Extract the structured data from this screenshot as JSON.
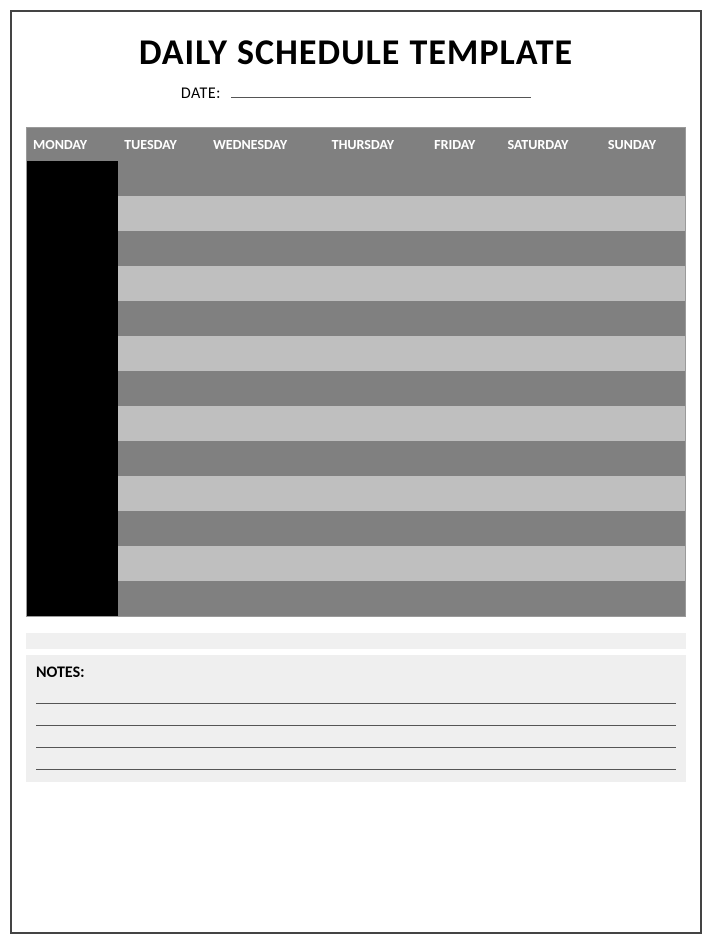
{
  "title": "DAILY SCHEDULE TEMPLATE",
  "date_label": "DATE:",
  "date_value": "",
  "columns": [
    "MONDAY",
    "TUESDAY",
    "WEDNESDAY",
    "THURSDAY",
    "FRIDAY",
    "SATURDAY",
    "SUNDAY"
  ],
  "rows": [
    {
      "stripe": "dark",
      "cells": [
        "",
        "",
        "",
        "",
        "",
        "",
        ""
      ]
    },
    {
      "stripe": "light",
      "cells": [
        "",
        "",
        "",
        "",
        "",
        "",
        ""
      ]
    },
    {
      "stripe": "dark",
      "cells": [
        "",
        "",
        "",
        "",
        "",
        "",
        ""
      ]
    },
    {
      "stripe": "light",
      "cells": [
        "",
        "",
        "",
        "",
        "",
        "",
        ""
      ]
    },
    {
      "stripe": "dark",
      "cells": [
        "",
        "",
        "",
        "",
        "",
        "",
        ""
      ]
    },
    {
      "stripe": "light",
      "cells": [
        "",
        "",
        "",
        "",
        "",
        "",
        ""
      ]
    },
    {
      "stripe": "dark",
      "cells": [
        "",
        "",
        "",
        "",
        "",
        "",
        ""
      ]
    },
    {
      "stripe": "light",
      "cells": [
        "",
        "",
        "",
        "",
        "",
        "",
        ""
      ]
    },
    {
      "stripe": "dark",
      "cells": [
        "",
        "",
        "",
        "",
        "",
        "",
        ""
      ]
    },
    {
      "stripe": "light",
      "cells": [
        "",
        "",
        "",
        "",
        "",
        "",
        ""
      ]
    },
    {
      "stripe": "dark",
      "cells": [
        "",
        "",
        "",
        "",
        "",
        "",
        ""
      ]
    },
    {
      "stripe": "light",
      "cells": [
        "",
        "",
        "",
        "",
        "",
        "",
        ""
      ]
    },
    {
      "stripe": "dark",
      "cells": [
        "",
        "",
        "",
        "",
        "",
        "",
        ""
      ]
    }
  ],
  "notes_label": "NOTES:",
  "notes_lines": [
    "",
    "",
    "",
    ""
  ]
}
